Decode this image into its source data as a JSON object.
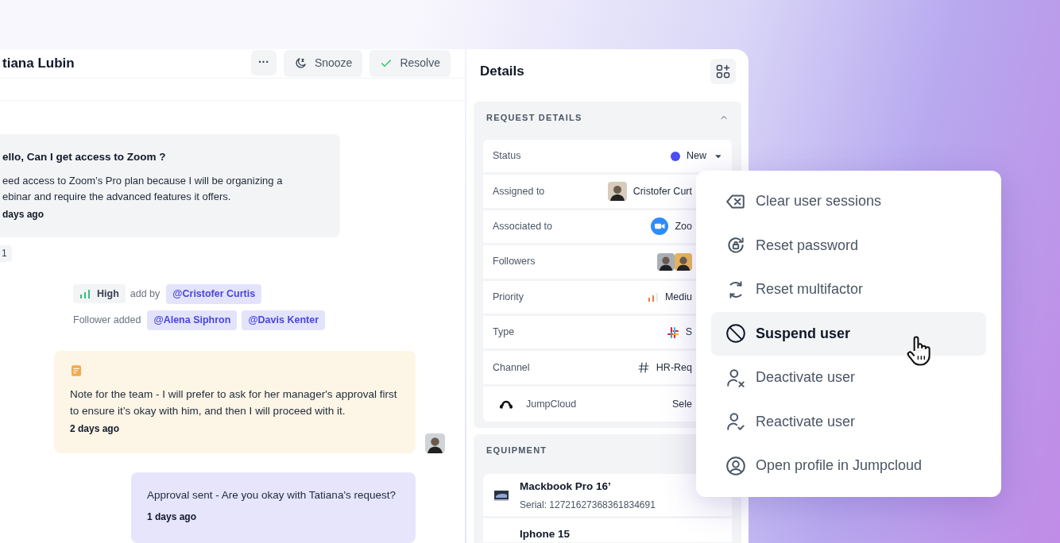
{
  "conversation": {
    "title": "tiana Lubin",
    "buttons": [
      {
        "kind": "more",
        "label": "···"
      },
      {
        "kind": "snooze",
        "label": "Snooze"
      },
      {
        "kind": "resolve",
        "label": "Resolve"
      }
    ]
  },
  "message": {
    "title": "ello, Can I get access to Zoom ?",
    "body_lines": [
      "eed access to Zoom’s Pro plan because I will be organizing a",
      "ebinar and require the advanced features it offers."
    ],
    "time": "days ago",
    "count": "1"
  },
  "activity": [
    {
      "kind": "priority",
      "priority": "High",
      "text": "add by",
      "mentions": [
        "@Cristofer Curtis"
      ]
    },
    {
      "kind": "followers",
      "text": "Follower added",
      "mentions": [
        "@Alena Siphron",
        "@Davis Kenter"
      ]
    }
  ],
  "note": {
    "text": "Note for the team - I will prefer to ask for her manager's approval first to ensure it’s okay with him, and then I will proceed with it.",
    "time": "2 days ago"
  },
  "approval": {
    "text": "Approval sent - Are you okay with Tatiana's request?",
    "time": "1 days ago"
  },
  "details": {
    "title": "Details",
    "request_details": {
      "title": "REQUEST DETAILS",
      "expanded": true,
      "rows": [
        {
          "kind": "status",
          "label": "Status",
          "value": "New"
        },
        {
          "kind": "person",
          "label": "Assigned to",
          "value": "Cristofer Curt"
        },
        {
          "kind": "app",
          "label": "Associated to",
          "value": "Zoo"
        },
        {
          "kind": "followers",
          "label": "Followers"
        },
        {
          "kind": "priority",
          "label": "Priority",
          "value": "Mediu"
        },
        {
          "kind": "type",
          "label": "Type",
          "value": "S"
        },
        {
          "kind": "channel",
          "label": "Channel",
          "value": "HR-Req"
        },
        {
          "kind": "integration",
          "label": "JumpCloud",
          "value": "Sele"
        }
      ]
    },
    "equipment": {
      "title": "EQUIPMENT",
      "items": [
        {
          "name": "Mackbook Pro 16’",
          "serial": "Serial: 12721627368361834691"
        },
        {
          "name": "Iphone 15"
        }
      ]
    }
  },
  "menu": {
    "items": [
      {
        "kind": "clear",
        "label": "Clear user sessions",
        "selected": false
      },
      {
        "kind": "password",
        "label": "Reset password",
        "selected": false
      },
      {
        "kind": "multifactor",
        "label": "Reset multifactor",
        "selected": false
      },
      {
        "kind": "suspend",
        "label": "Suspend user",
        "selected": true
      },
      {
        "kind": "deactivate",
        "label": "Deactivate user",
        "selected": false
      },
      {
        "kind": "reactivate",
        "label": "Reactivate user",
        "selected": false
      },
      {
        "kind": "profile",
        "label": "Open profile in Jumpcloud",
        "selected": false
      }
    ]
  }
}
